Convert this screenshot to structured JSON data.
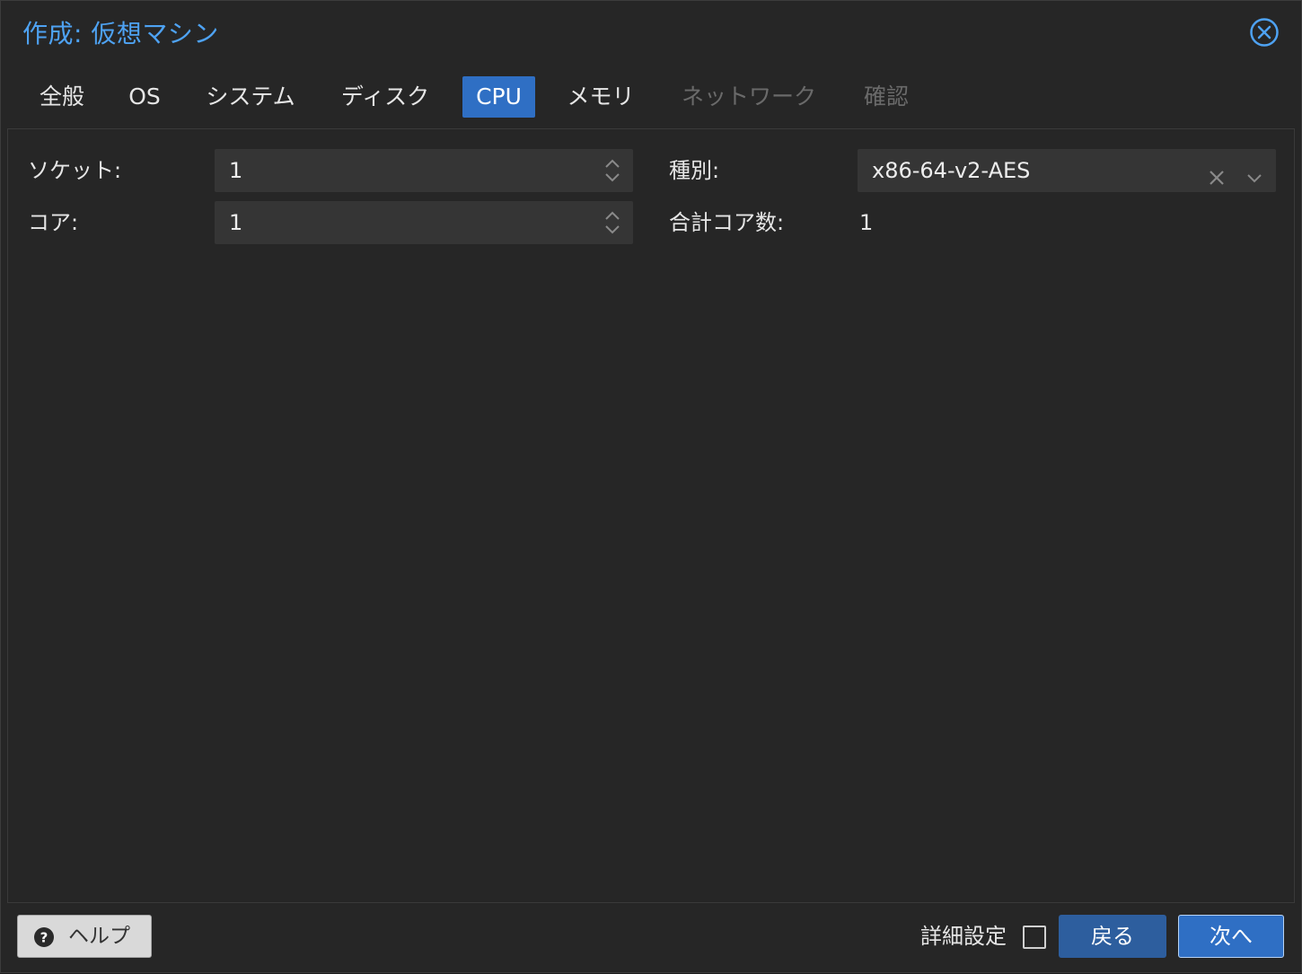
{
  "dialog": {
    "title": "作成: 仮想マシン"
  },
  "tabs": [
    {
      "label": "全般",
      "state": "normal"
    },
    {
      "label": "OS",
      "state": "normal"
    },
    {
      "label": "システム",
      "state": "normal"
    },
    {
      "label": "ディスク",
      "state": "normal"
    },
    {
      "label": "CPU",
      "state": "active"
    },
    {
      "label": "メモリ",
      "state": "normal"
    },
    {
      "label": "ネットワーク",
      "state": "disabled"
    },
    {
      "label": "確認",
      "state": "disabled"
    }
  ],
  "cpu": {
    "sockets_label": "ソケット:",
    "sockets_value": "1",
    "cores_label": "コア:",
    "cores_value": "1",
    "type_label": "種別:",
    "type_value": "x86-64-v2-AES",
    "total_cores_label": "合計コア数:",
    "total_cores_value": "1"
  },
  "footer": {
    "help_label": "ヘルプ",
    "advanced_label": "詳細設定",
    "advanced_checked": false,
    "back_label": "戻る",
    "next_label": "次へ"
  },
  "colors": {
    "accent": "#2f6fc4",
    "title": "#4ea2f2",
    "background": "#262626",
    "field": "#353535"
  }
}
